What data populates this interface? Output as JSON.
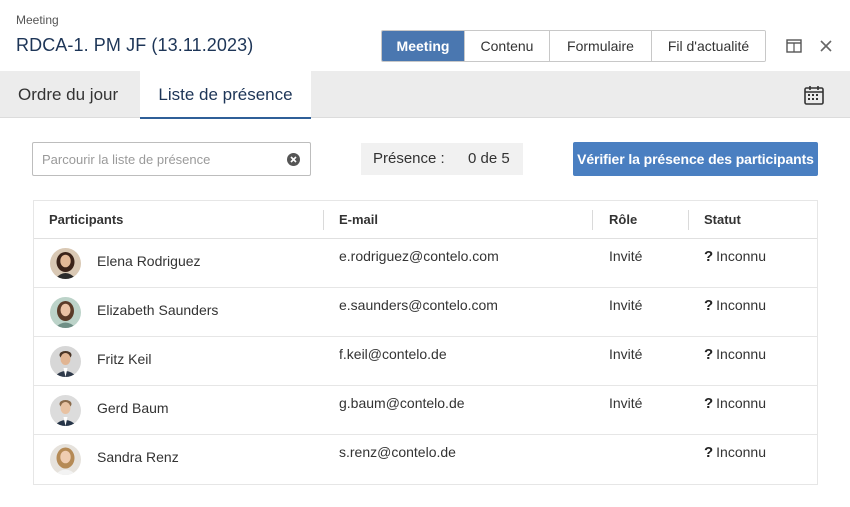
{
  "header": {
    "kicker": "Meeting",
    "title": "RDCA-1. PM JF (13.11.2023)",
    "segments": [
      {
        "label": "Meeting",
        "active": true
      },
      {
        "label": "Contenu",
        "active": false
      },
      {
        "label": "Formulaire",
        "active": false
      },
      {
        "label": "Fil d'actualité",
        "active": false
      }
    ],
    "icons": {
      "restore": "window-restore-icon",
      "close": "close-icon"
    }
  },
  "tabs": [
    {
      "label": "Ordre du jour",
      "active": false
    },
    {
      "label": "Liste de présence",
      "active": true
    }
  ],
  "calendar_icon": "calendar-icon",
  "search": {
    "placeholder": "Parcourir la liste de présence",
    "value": ""
  },
  "presence": {
    "label": "Présence :",
    "value": "0 de 5"
  },
  "verify_button": "Vérifier la présence des participants",
  "table": {
    "columns": [
      "Participants",
      "E-mail",
      "Rôle",
      "Statut"
    ],
    "rows": [
      {
        "name": "Elena Rodriguez",
        "email": "e.rodriguez@contelo.com",
        "role": "Invité",
        "status": "Inconnu"
      },
      {
        "name": "Elizabeth Saunders",
        "email": "e.saunders@contelo.com",
        "role": "Invité",
        "status": "Inconnu"
      },
      {
        "name": "Fritz Keil",
        "email": "f.keil@contelo.de",
        "role": "Invité",
        "status": "Inconnu"
      },
      {
        "name": "Gerd Baum",
        "email": "g.baum@contelo.de",
        "role": "Invité",
        "status": "Inconnu"
      },
      {
        "name": "Sandra Renz",
        "email": "s.renz@contelo.de",
        "role": "",
        "status": "Inconnu"
      }
    ]
  },
  "colors": {
    "accent": "#4a77b0",
    "title": "#1d3557",
    "button": "#4a7fc1"
  }
}
